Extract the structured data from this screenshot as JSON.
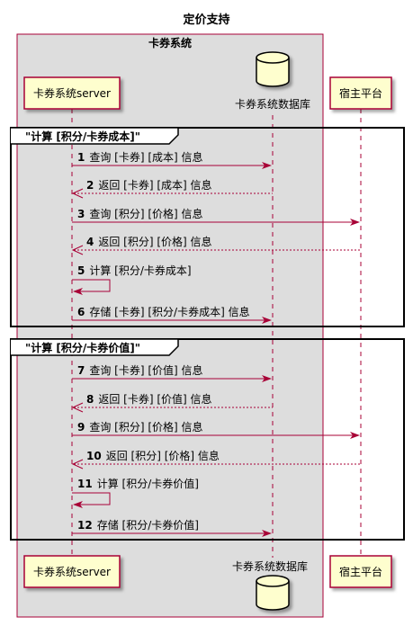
{
  "title": "定价支持",
  "group": {
    "label": "卡券系统"
  },
  "participants": {
    "server": "卡券系统server",
    "database": "卡券系统数据库",
    "host": "宿主平台"
  },
  "fragments": [
    {
      "label": "\"计算 [积分/卡券成本]\""
    },
    {
      "label": "\"计算 [积分/卡券价值]\""
    }
  ],
  "messages": [
    {
      "num": "1",
      "text": "查询 [卡券] [成本] 信息"
    },
    {
      "num": "2",
      "text": "返回 [卡券] [成本] 信息"
    },
    {
      "num": "3",
      "text": "查询 [积分] [价格] 信息"
    },
    {
      "num": "4",
      "text": "返回 [积分] [价格] 信息"
    },
    {
      "num": "5",
      "text": "计算 [积分/卡券成本]"
    },
    {
      "num": "6",
      "text": "存储 [卡券] [积分/卡券成本] 信息"
    },
    {
      "num": "7",
      "text": "查询 [卡券] [价值] 信息"
    },
    {
      "num": "8",
      "text": "返回 [卡券] [价值] 信息"
    },
    {
      "num": "9",
      "text": "查询 [积分] [价格] 信息"
    },
    {
      "num": "10",
      "text": "返回 [积分] [价格] 信息"
    },
    {
      "num": "11",
      "text": "计算 [积分/卡券价值]"
    },
    {
      "num": "12",
      "text": "存储 [积分/卡券价值]"
    }
  ],
  "colors": {
    "group_fill": "#dddddd",
    "participant_fill": "#fefece",
    "line": "#a80036"
  }
}
